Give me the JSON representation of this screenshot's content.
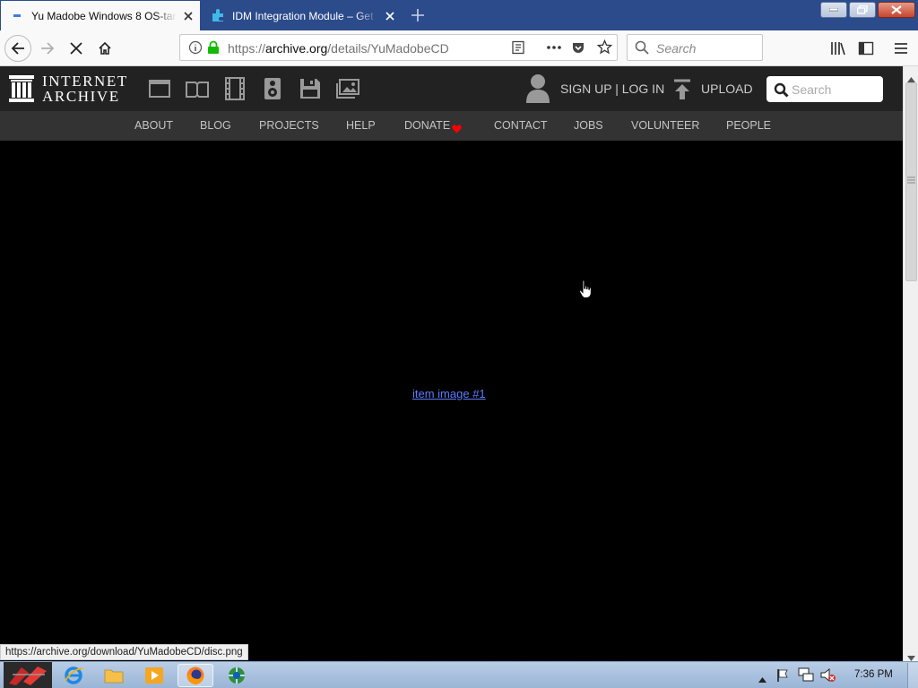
{
  "browser": {
    "tabs": [
      {
        "title": "Yu Madobe Windows 8 OS-tan",
        "active": true
      },
      {
        "title": "IDM Integration Module – Get",
        "active": false
      }
    ],
    "url_prefix": "https://",
    "url_host": "archive.org",
    "url_path": "/details/YuMadobeCD",
    "search_placeholder": "Search",
    "status_url": "https://archive.org/download/YuMadobeCD/disc.png"
  },
  "ia_header": {
    "logo_line1": "INTERNET",
    "logo_line2": "ARCHIVE",
    "media_icons": [
      "web-icon",
      "texts-icon",
      "video-icon",
      "audio-icon",
      "software-icon",
      "images-icon"
    ],
    "signup_login": "SIGN UP | LOG IN",
    "upload": "UPLOAD",
    "search_placeholder": "Search"
  },
  "ia_nav": {
    "items": [
      "ABOUT",
      "BLOG",
      "PROJECTS",
      "HELP",
      "DONATE",
      "CONTACT",
      "JOBS",
      "VOLUNTEER",
      "PEOPLE"
    ]
  },
  "content": {
    "item_link": "item image #1"
  },
  "taskbar": {
    "apps": [
      "internet-explorer-icon",
      "file-explorer-icon",
      "media-player-icon",
      "firefox-icon",
      "network-app-icon"
    ],
    "clock": "7:36 PM"
  },
  "colors": {
    "tabstrip": "#2b4b8b",
    "ia_header": "#222222",
    "ia_subnav": "#333333",
    "link": "#5c7cff",
    "donate_heart": "#ff0000"
  }
}
